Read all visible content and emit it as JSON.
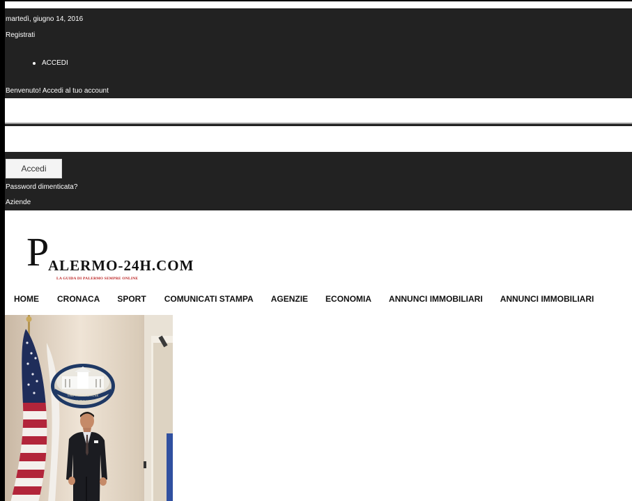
{
  "topbar": {
    "date": "martedì, giugno 14, 2016",
    "register": "Registrati",
    "login_item": "ACCEDI",
    "welcome": "Benvenuto! Accedi al tuo account",
    "username_value": "",
    "password_value": "",
    "login_button": "Accedi",
    "forgot_password": "Password dimenticata?",
    "companies": "Aziende",
    "background_color": "#222222"
  },
  "logo": {
    "initial": "P",
    "rest": "ALERMO-24H.COM",
    "tagline": "LA GUIDA DI PALERMO SEMPRE ONLINE",
    "tagline_color": "#b91a1a"
  },
  "nav": {
    "items": [
      {
        "label": "HOME"
      },
      {
        "label": "CRONACA"
      },
      {
        "label": "SPORT"
      },
      {
        "label": "COMUNICATI STAMPA"
      },
      {
        "label": "AGENZIE"
      },
      {
        "label": "ECONOMIA"
      },
      {
        "label": "ANNUNCI IMMOBILIARI"
      },
      {
        "label": "ANNUNCI IMMOBILIARI"
      }
    ]
  },
  "photo": {
    "seal_text": "THE WHITE HOUSE",
    "seal_subtext": "WASHINGTON"
  }
}
